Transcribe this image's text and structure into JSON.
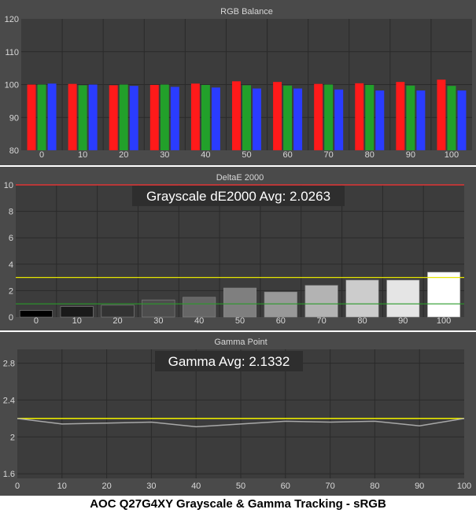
{
  "caption": "AOC Q27G4XY Grayscale & Gamma Tracking - sRGB",
  "colors": {
    "background": "#4a4a4a",
    "plot": "#3c3c3c",
    "gridline": "#2a2a2a",
    "text": "#d8d8d8",
    "red": "#ff1a1a",
    "green": "#22a02a",
    "blue": "#2a3cff",
    "yellow": "#e6e600",
    "tolerance_green": "#2a9a2a",
    "limit_red": "#ff3030",
    "gamma_line": "#a8a8a8"
  },
  "chart_data": [
    {
      "type": "bar",
      "title": "RGB Balance",
      "categories": [
        "0",
        "10",
        "20",
        "30",
        "40",
        "50",
        "60",
        "70",
        "80",
        "90",
        "100"
      ],
      "ylim": [
        80,
        120
      ],
      "yticks": [
        80,
        90,
        100,
        110,
        120
      ],
      "grid": true,
      "series": [
        {
          "color": "red",
          "values": [
            100.0,
            100.2,
            99.8,
            99.9,
            100.3,
            101.0,
            100.8,
            100.2,
            100.4,
            100.8,
            101.5
          ]
        },
        {
          "color": "green",
          "values": [
            100.0,
            99.8,
            100.0,
            100.0,
            99.9,
            99.8,
            99.7,
            100.0,
            99.9,
            99.7,
            99.6
          ]
        },
        {
          "color": "blue",
          "values": [
            100.3,
            100.0,
            99.6,
            99.3,
            99.1,
            98.8,
            98.8,
            98.5,
            98.2,
            98.2,
            98.2
          ]
        }
      ]
    },
    {
      "type": "bar",
      "title": "DeltaE 2000",
      "annotation": "Grayscale dE2000 Avg: 2.0263",
      "categories": [
        "0",
        "10",
        "20",
        "30",
        "40",
        "50",
        "60",
        "70",
        "80",
        "90",
        "100"
      ],
      "ylim": [
        0,
        10
      ],
      "yticks": [
        0,
        2,
        4,
        6,
        8,
        10
      ],
      "grid": true,
      "reference_lines": [
        {
          "y": 10,
          "color": "limit_red"
        },
        {
          "y": 3,
          "color": "yellow"
        },
        {
          "y": 1,
          "color": "tolerance_green"
        }
      ],
      "values": [
        0.5,
        0.8,
        0.9,
        1.3,
        1.5,
        2.2,
        1.9,
        2.4,
        2.8,
        2.8,
        3.4
      ],
      "bar_gray_levels": [
        0,
        10,
        20,
        30,
        40,
        50,
        60,
        70,
        80,
        90,
        100
      ]
    },
    {
      "type": "line",
      "title": "Gamma Point",
      "annotation": "Gamma Avg: 2.1332",
      "x": [
        0,
        10,
        20,
        30,
        40,
        50,
        60,
        70,
        80,
        90,
        100
      ],
      "xticks": [
        "0",
        "10",
        "20",
        "30",
        "40",
        "50",
        "60",
        "70",
        "80",
        "90",
        "100"
      ],
      "ylim": [
        1.55,
        2.95
      ],
      "yticks": [
        "1.6",
        "2",
        "2.4",
        "2.8"
      ],
      "grid": true,
      "target": 2.2,
      "values": [
        2.2,
        2.14,
        2.15,
        2.16,
        2.11,
        2.14,
        2.17,
        2.16,
        2.17,
        2.12,
        2.2
      ]
    }
  ]
}
